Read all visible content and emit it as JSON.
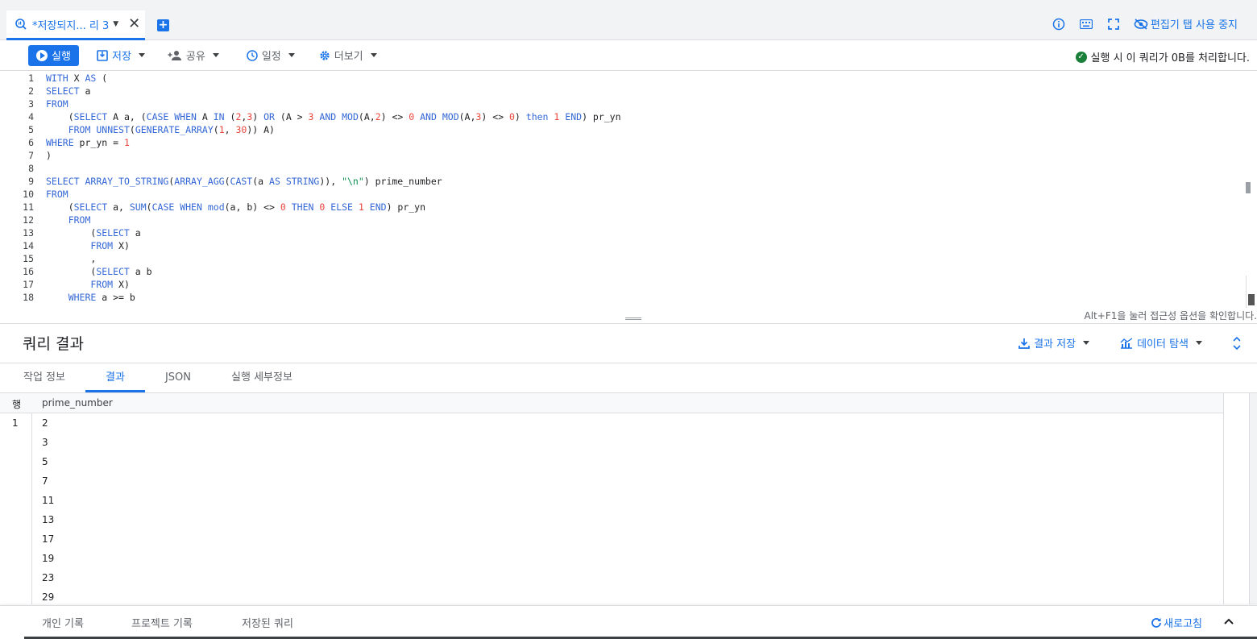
{
  "tab": {
    "title": "*저장되지... 리 3"
  },
  "top_right": {
    "hide_tab_label": "편집기 탭 사용 중지"
  },
  "toolbar": {
    "run": "실행",
    "save": "저장",
    "share": "공유",
    "schedule": "일정",
    "more": "더보기",
    "status": "실행 시 이 쿼리가 0B를 처리합니다."
  },
  "editor": {
    "line_numbers": [
      "1",
      "2",
      "3",
      "4",
      "5",
      "6",
      "7",
      "8",
      "9",
      "10",
      "11",
      "12",
      "13",
      "14",
      "15",
      "16",
      "17",
      "18"
    ],
    "a11y_hint": "Alt+F1을 눌러 접근성 옵션을 확인합니다."
  },
  "results": {
    "title": "쿼리 결과",
    "save_results": "결과 저장",
    "explore_data": "데이터 탐색",
    "tabs": [
      "작업 정보",
      "결과",
      "JSON",
      "실행 세부정보"
    ],
    "row_header": "행",
    "column": "prime_number",
    "row_number": "1",
    "values": [
      "2",
      "3",
      "5",
      "7",
      "11",
      "13",
      "17",
      "19",
      "23",
      "29"
    ]
  },
  "footer": {
    "personal_history": "개인 기록",
    "project_history": "프로젝트 기록",
    "saved_queries": "저장된 쿼리",
    "refresh": "새로고침"
  },
  "colors": {
    "accent": "#1a73e8",
    "keyword": "#3367d6",
    "number": "#e8453c",
    "string": "#0d904f",
    "success": "#188038"
  }
}
